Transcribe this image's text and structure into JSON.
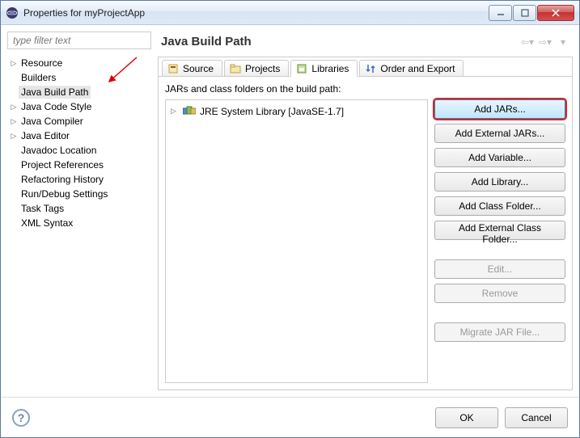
{
  "window": {
    "title": "Properties for myProjectApp"
  },
  "sidebar": {
    "filter_placeholder": "type filter text",
    "items": [
      {
        "label": "Resource",
        "expandable": true
      },
      {
        "label": "Builders",
        "expandable": false
      },
      {
        "label": "Java Build Path",
        "expandable": false,
        "selected": true
      },
      {
        "label": "Java Code Style",
        "expandable": true
      },
      {
        "label": "Java Compiler",
        "expandable": true
      },
      {
        "label": "Java Editor",
        "expandable": true
      },
      {
        "label": "Javadoc Location",
        "expandable": false
      },
      {
        "label": "Project References",
        "expandable": false
      },
      {
        "label": "Refactoring History",
        "expandable": false
      },
      {
        "label": "Run/Debug Settings",
        "expandable": false
      },
      {
        "label": "Task Tags",
        "expandable": false
      },
      {
        "label": "XML Syntax",
        "expandable": false
      }
    ]
  },
  "page": {
    "title": "Java Build Path"
  },
  "tabs": [
    {
      "label": "Source",
      "icon": "source"
    },
    {
      "label": "Projects",
      "icon": "projects"
    },
    {
      "label": "Libraries",
      "icon": "libraries",
      "active": true
    },
    {
      "label": "Order and Export",
      "icon": "order"
    }
  ],
  "libraries": {
    "description": "JARs and class folders on the build path:",
    "entries": [
      {
        "label": "JRE System Library [JavaSE-1.7]"
      }
    ],
    "buttons": {
      "add_jars": "Add JARs...",
      "add_external_jars": "Add External JARs...",
      "add_variable": "Add Variable...",
      "add_library": "Add Library...",
      "add_class_folder": "Add Class Folder...",
      "add_external_class_folder": "Add External Class Folder...",
      "edit": "Edit...",
      "remove": "Remove",
      "migrate": "Migrate JAR File..."
    }
  },
  "footer": {
    "ok": "OK",
    "cancel": "Cancel"
  }
}
